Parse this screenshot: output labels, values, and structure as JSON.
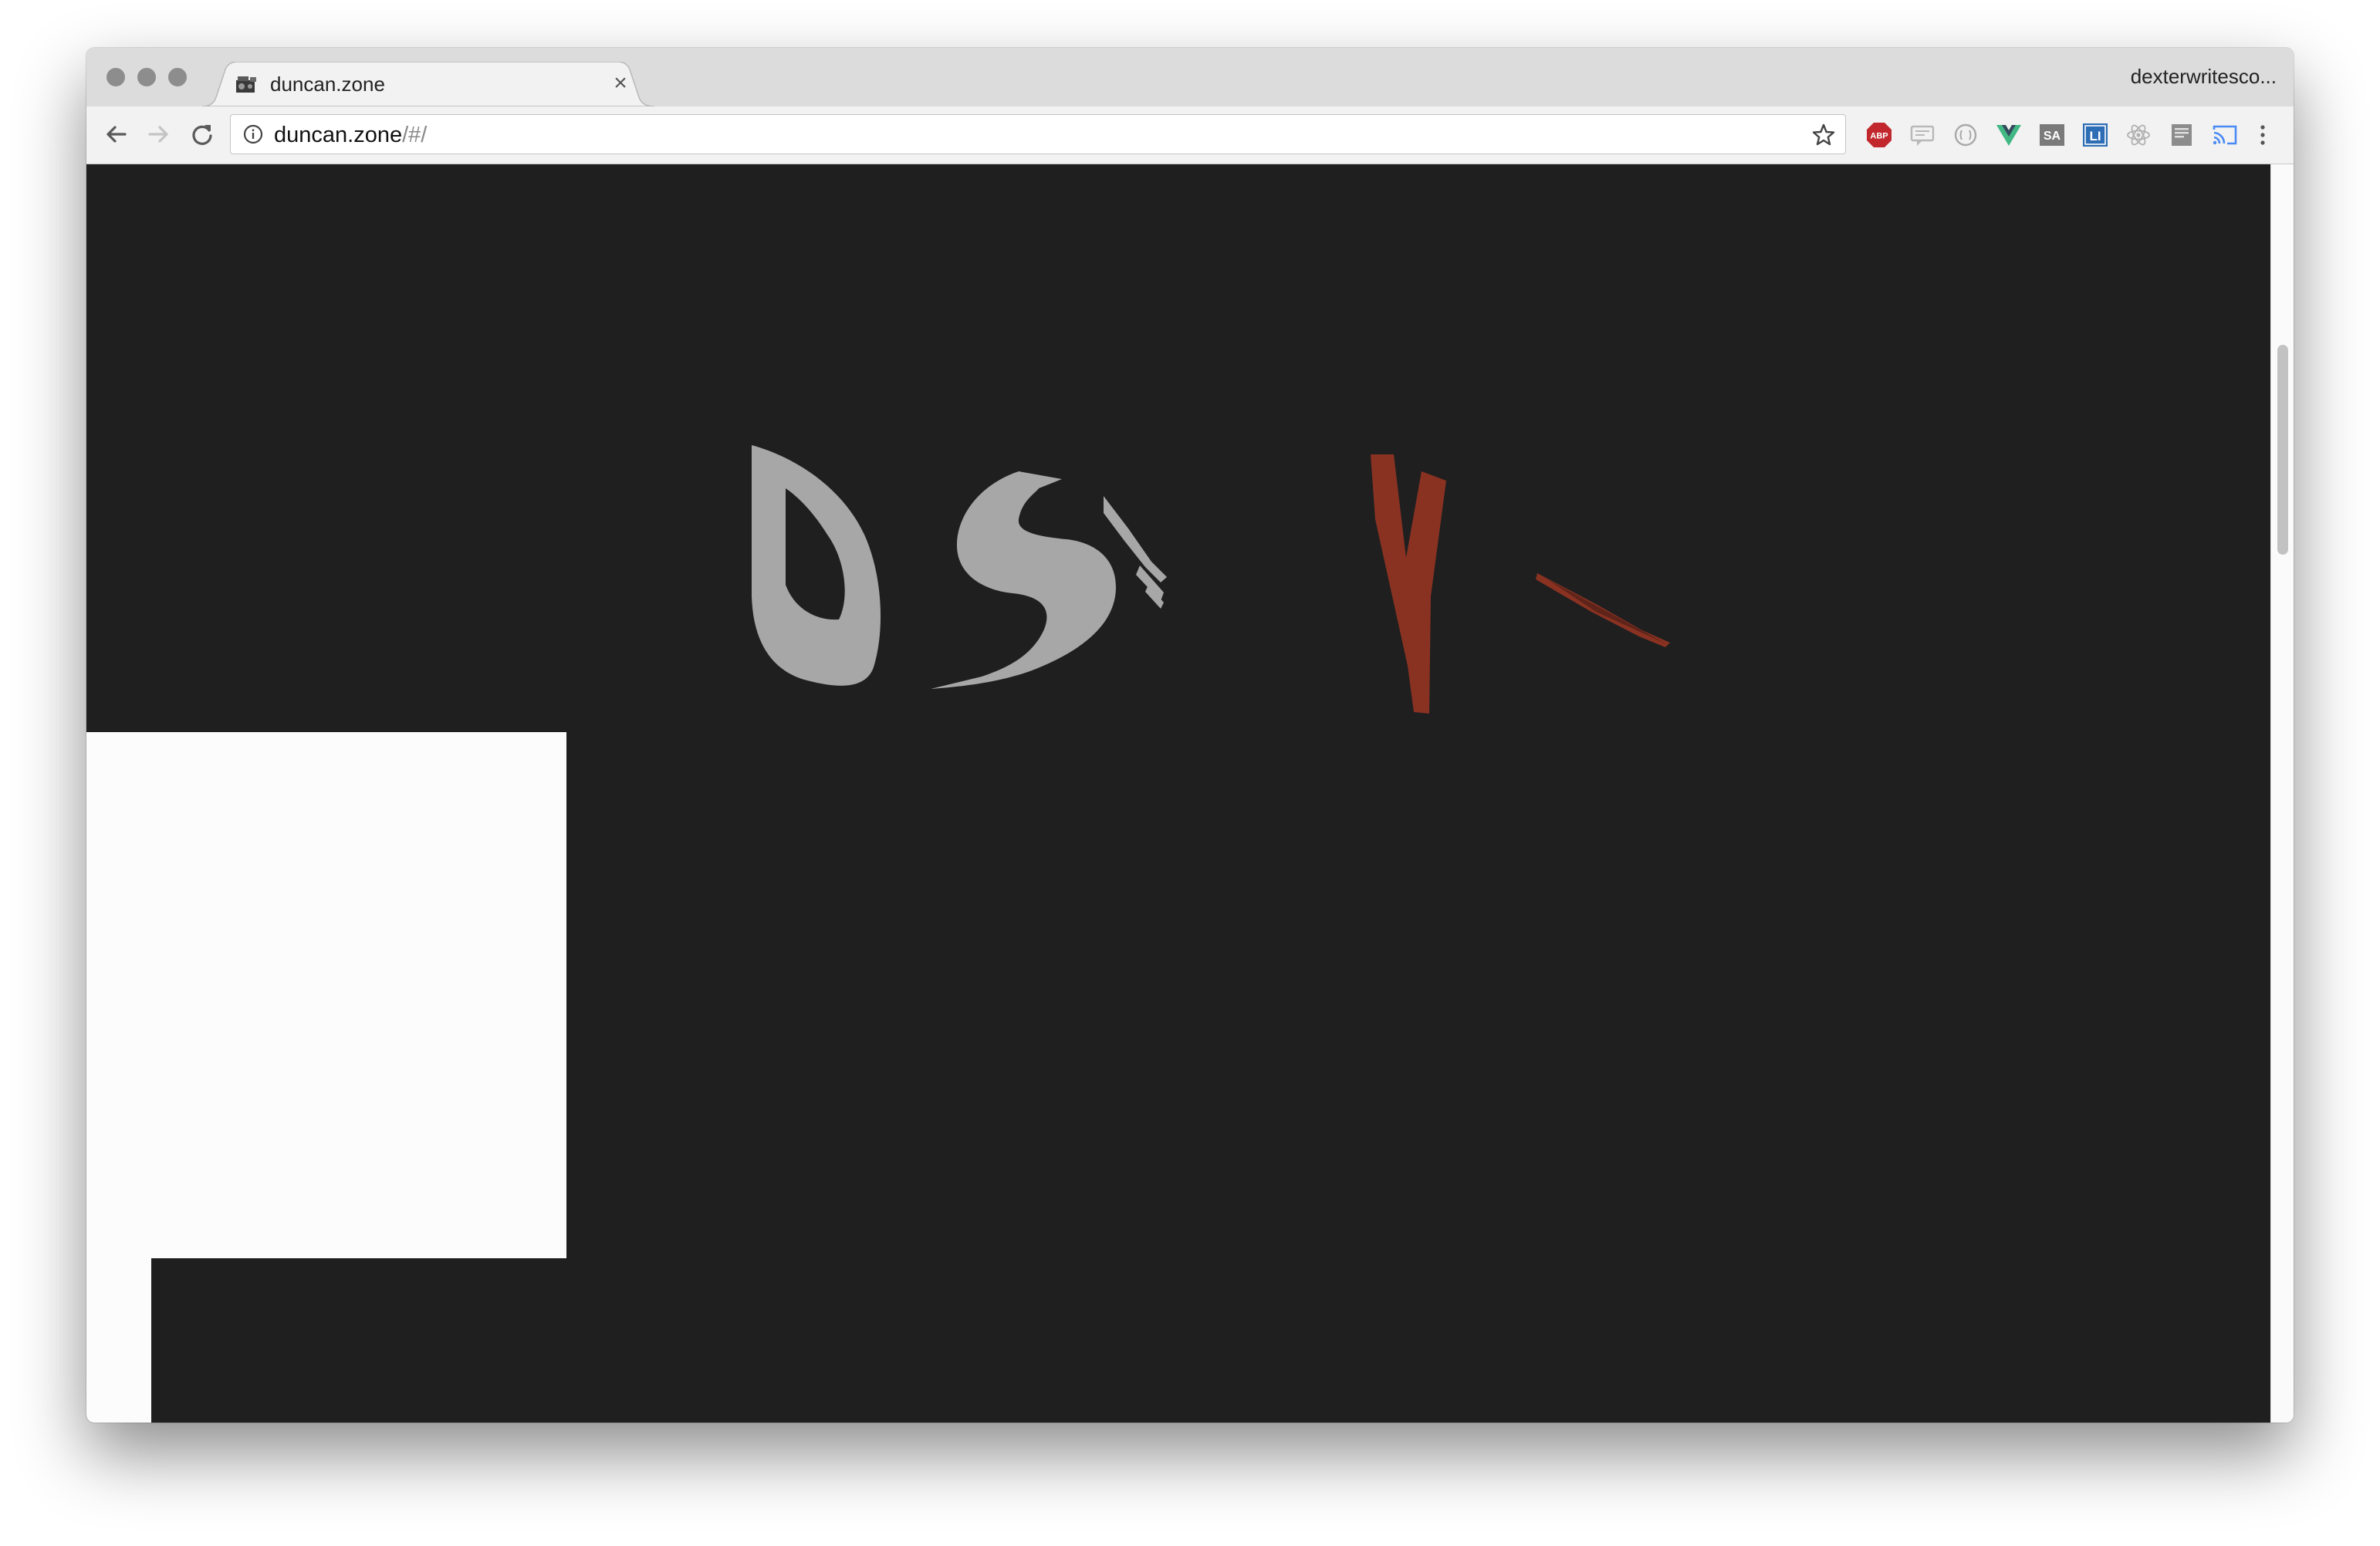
{
  "browser": {
    "tab": {
      "title": "duncan.zone",
      "close_glyph": "×",
      "favicon": "page-favicon-icon"
    },
    "profile_name": "dexterwritesco...",
    "address_bar": {
      "host": "duncan.zone",
      "path": "/#/",
      "info_icon": "info-icon",
      "bookmark_icon": "star-icon"
    },
    "nav_icons": [
      "back-arrow-icon",
      "forward-arrow-icon",
      "reload-icon"
    ],
    "extensions": [
      {
        "name": "adblock-plus-icon",
        "label": "ABP",
        "color": "#c1272d"
      },
      {
        "name": "feedback-icon",
        "label": "",
        "color": "#b8b8b8"
      },
      {
        "name": "circle-ext-icon",
        "label": "",
        "color": "#a8a8a8"
      },
      {
        "name": "vue-devtools-icon",
        "label": "V",
        "color": "#41b883"
      },
      {
        "name": "sa-ext-icon",
        "label": "SA",
        "color": "#7a7a7a"
      },
      {
        "name": "linkedin-ext-icon",
        "label": "LI",
        "color": "#2d6db5"
      },
      {
        "name": "react-devtools-icon",
        "label": "",
        "color": "#b0b0b0"
      },
      {
        "name": "reader-ext-icon",
        "label": "",
        "color": "#8c8c8c"
      },
      {
        "name": "cast-icon",
        "label": "",
        "color": "#4a8af4"
      },
      {
        "name": "menu-dots-icon",
        "label": "",
        "color": "#555555"
      }
    ]
  },
  "page": {
    "background": "#1f1f20",
    "glyphs": [
      {
        "name": "glyph-d",
        "char": "D",
        "color": "#a7a7a7"
      },
      {
        "name": "glyph-s",
        "char": "S",
        "color": "#a7a7a7"
      },
      {
        "name": "glyph-fragment-gray",
        "char": "",
        "color": "#a7a7a7"
      },
      {
        "name": "glyph-v",
        "char": "V",
        "color": "#8a3222"
      },
      {
        "name": "glyph-fragment-red",
        "char": "",
        "color": "#8a3222"
      }
    ]
  }
}
